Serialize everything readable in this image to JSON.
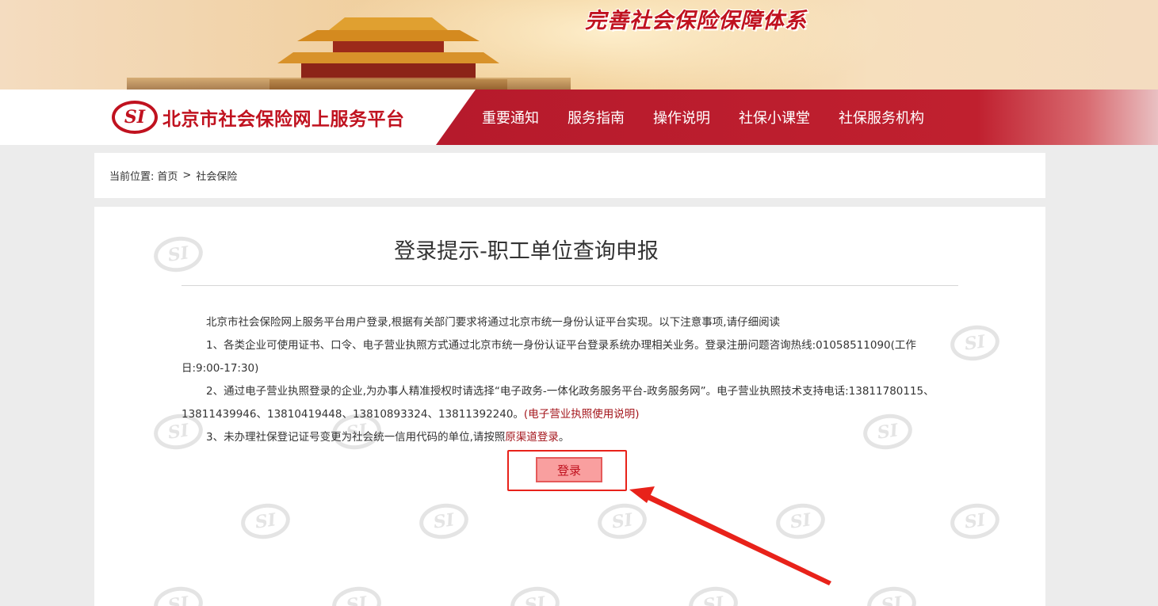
{
  "banner": {
    "slogan": "完善社会保险保障体系"
  },
  "header": {
    "logo_mark": "SI",
    "site_name": "北京市社会保险网上服务平台",
    "nav": [
      "重要通知",
      "服务指南",
      "操作说明",
      "社保小课堂",
      "社保服务机构"
    ]
  },
  "breadcrumb": {
    "prefix": "当前位置:",
    "home": "首页",
    "separator": ">",
    "current": "社会保险"
  },
  "main": {
    "title": "登录提示-职工单位查询申报",
    "intro": "北京市社会保险网上服务平台用户登录,根据有关部门要求将通过北京市统一身份认证平台实现。以下注意事项,请仔细阅读",
    "item1": "1、各类企业可使用证书、口令、电子营业执照方式通过北京市统一身份认证平台登录系统办理相关业务。登录注册问题咨询热线:01058511090(工作日:9:00-17:30)",
    "item2": "2、通过电子营业执照登录的企业,为办事人精准授权时请选择“电子政务-一体化政务服务平台-政务服务网”。电子营业执照技术支持电话:13811780115、13811439946、13810419448、13810893324、13811392240。",
    "item2_link": "(电子营业执照使用说明)",
    "item3": "3、未办理社保登记证号变更为社会统一信用代码的单位,请按照",
    "item3_link": "原渠道登录",
    "item3_end": "。",
    "login_label": "登录",
    "watermark": "SI"
  },
  "colors": {
    "brand_red": "#c0121f",
    "nav_band": "#b61a2c",
    "button_bg": "#f99f9f",
    "annotation_red": "#e8221a"
  }
}
